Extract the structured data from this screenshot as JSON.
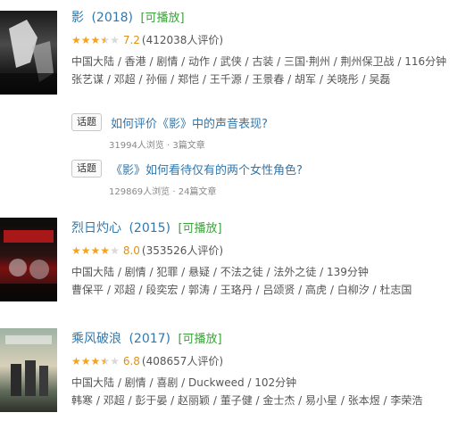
{
  "movies": [
    {
      "title": "影",
      "year": "(2018)",
      "playable": "[可播放]",
      "stars": "3.5",
      "score": "7.2",
      "count": "(412038人评价)",
      "meta1": "中国大陆 / 香港 / 剧情 / 动作 / 武侠 / 古装 / 三国·荆州 / 荆州保卫战 / 116分钟",
      "meta2": "张艺谋 / 邓超 / 孙俪 / 郑恺 / 王千源 / 王景春 / 胡军 / 关晓彤 / 吴磊"
    },
    {
      "title": "烈日灼心",
      "year": "(2015)",
      "playable": "[可播放]",
      "stars": "4",
      "score": "8.0",
      "count": "(353526人评价)",
      "meta1": "中国大陆 / 剧情 / 犯罪 / 悬疑 / 不法之徒 / 法外之徒 / 139分钟",
      "meta2": "曹保平 / 邓超 / 段奕宏 / 郭涛 / 王珞丹 / 吕颂贤 / 高虎 / 白柳汐 / 杜志国"
    },
    {
      "title": "乘风破浪",
      "year": "(2017)",
      "playable": "[可播放]",
      "stars": "3.5",
      "score": "6.8",
      "count": "(408657人评价)",
      "meta1": "中国大陆 / 剧情 / 喜剧 / Duckweed / 102分钟",
      "meta2": "韩寒 / 邓超 / 彭于晏 / 赵丽颖 / 董子健 / 金士杰 / 易小星 / 张本煜 / 李荣浩"
    }
  ],
  "topics": [
    {
      "tag": "话题",
      "title": "如何评价《影》中的声音表现?",
      "stat": "31994人浏览 · 3篇文章"
    },
    {
      "tag": "话题",
      "title": "《影》如何看待仅有的两个女性角色?",
      "stat": "129869人浏览 · 24篇文章"
    }
  ]
}
